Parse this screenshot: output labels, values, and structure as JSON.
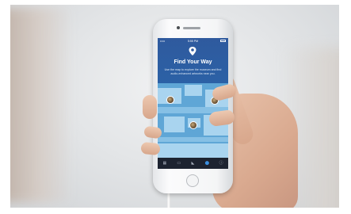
{
  "screen": {
    "status": {
      "time": "5:55 PM"
    },
    "title": "Find Your Way",
    "body": "Use the map to explore the museum and find audio-enhanced artworks near you.",
    "tabs": [
      {
        "icon": "grid-icon",
        "label": "",
        "active": false
      },
      {
        "icon": "collection-icon",
        "label": "",
        "active": false
      },
      {
        "icon": "tours-icon",
        "label": "",
        "active": false
      },
      {
        "icon": "map-pin-icon",
        "label": "",
        "active": true
      },
      {
        "icon": "info-icon",
        "label": "",
        "active": false
      }
    ]
  },
  "colors": {
    "screen_header": "#2f5a9e",
    "map_background": "#5fa6d6",
    "map_rooms": "#a9d4ef",
    "tab_bar": "#1d2330",
    "tab_active": "#3b8fe0",
    "background": "#e3e5e7"
  }
}
